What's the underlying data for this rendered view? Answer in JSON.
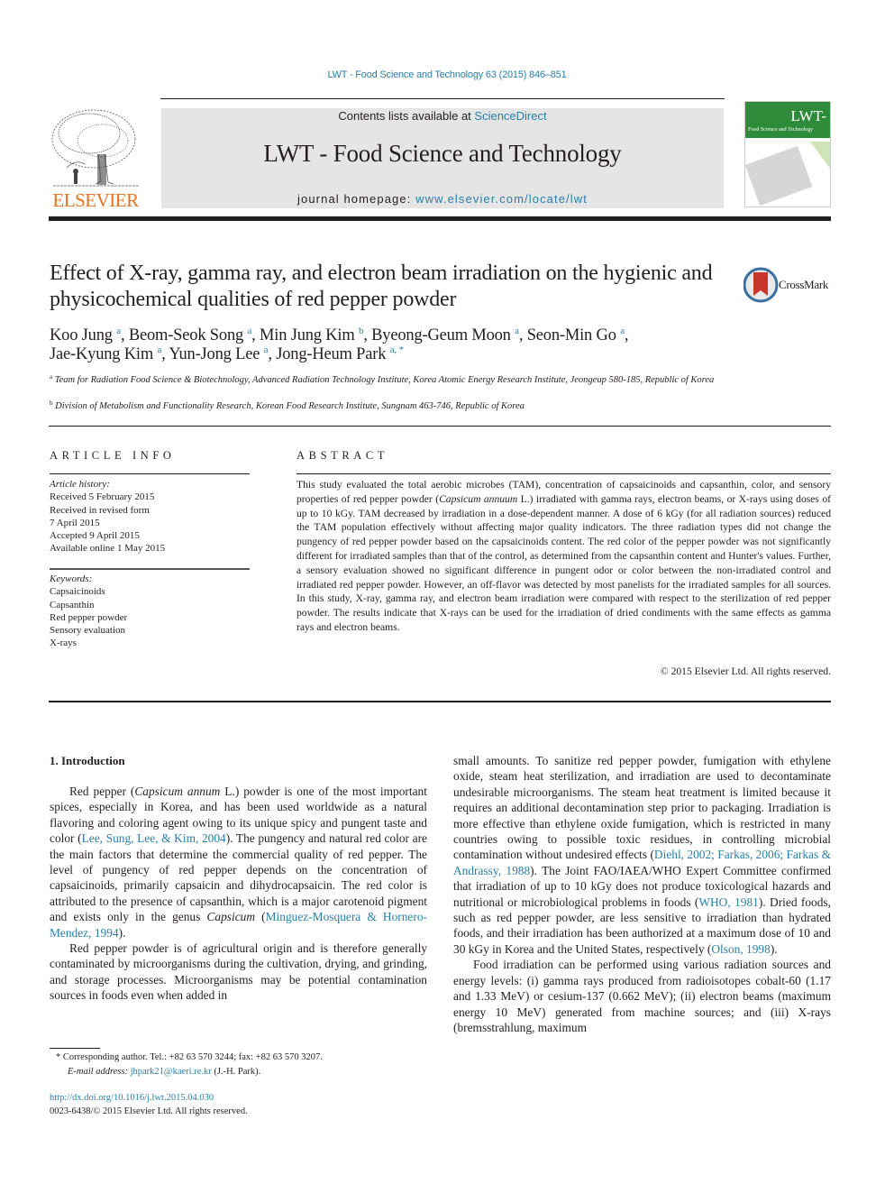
{
  "header": {
    "journal_ref": "LWT - Food Science and Technology 63 (2015) 846–851",
    "publisher": "ELSEVIER",
    "contents_prefix": "Contents lists available at ",
    "contents_link": "ScienceDirect",
    "journal_title": "LWT - Food Science and Technology",
    "homepage_prefix": "journal homepage: ",
    "homepage_link": "www.elsevier.com/locate/lwt",
    "cover_title": "LWT-",
    "cover_subtitle": "Food Science and Technology",
    "crossmark": "CrossMark"
  },
  "article": {
    "title": "Effect of X-ray, gamma ray, and electron beam irradiation on the hygienic and physicochemical qualities of red pepper powder",
    "authors": [
      {
        "name": "Koo Jung",
        "aff": "a",
        "sep": ", "
      },
      {
        "name": "Beom-Seok Song",
        "aff": "a",
        "sep": ", "
      },
      {
        "name": "Min Jung Kim",
        "aff": "b",
        "sep": ", "
      },
      {
        "name": "Byeong-Geum Moon",
        "aff": "a",
        "sep": ", "
      },
      {
        "name": "Seon-Min Go",
        "aff": "a",
        "sep": ","
      },
      {
        "name": "Jae-Kyung Kim",
        "aff": "a",
        "sep": ", "
      },
      {
        "name": "Yun-Jong Lee",
        "aff": "a",
        "sep": ", "
      },
      {
        "name": "Jong-Heum Park",
        "aff": "a, *",
        "sep": ""
      }
    ],
    "affiliations": [
      {
        "mark": "a",
        "text": "Team for Radiation Food Science & Biotechnology, Advanced Radiation Technology Institute, Korea Atomic Energy Research Institute, Jeongeup 580-185, Republic of Korea"
      },
      {
        "mark": "b",
        "text": "Division of Metabolism and Functionality Research, Korean Food Research Institute, Sungnam 463-746, Republic of Korea"
      }
    ]
  },
  "article_info": {
    "heading": "ARTICLE INFO",
    "history_label": "Article history:",
    "history": [
      "Received 5 February 2015",
      "Received in revised form",
      "7 April 2015",
      "Accepted 9 April 2015",
      "Available online 1 May 2015"
    ],
    "keywords_label": "Keywords:",
    "keywords": [
      "Capsaicinoids",
      "Capsanthin",
      "Red pepper powder",
      "Sensory evaluation",
      "X-rays"
    ]
  },
  "abstract": {
    "heading": "ABSTRACT",
    "text_1": "This study evaluated the total aerobic microbes (TAM), concentration of capsaicinoids and capsanthin, color, and sensory properties of red pepper powder (",
    "species": "Capsicum annuum",
    "text_2": " L.) irradiated with gamma rays, electron beams, or X-rays using doses of up to 10 kGy. TAM decreased by irradiation in a dose-dependent manner. A dose of 6 kGy (for all radiation sources) reduced the TAM population effectively without affecting major quality indicators. The three radiation types did not change the pungency of red pepper powder based on the capsaicinoids content. The red color of the pepper powder was not significantly different for irradiated samples than that of the control, as determined from the capsanthin content and Hunter's values. Further, a sensory evaluation showed no significant difference in pungent odor or color between the non-irradiated control and irradiated red pepper powder. However, an off-flavor was detected by most panelists for the irradiated samples for all sources. In this study, X-ray, gamma ray, and electron beam irradiation were compared with respect to the sterilization of red pepper powder. The results indicate that X-rays can be used for the irradiation of dried condiments with the same effects as gamma rays and electron beams.",
    "copyright": "© 2015 Elsevier Ltd. All rights reserved."
  },
  "intro": {
    "heading": "1.  Introduction",
    "p1_a": "Red pepper (",
    "p1_species": "Capsicum annum",
    "p1_b": " L.) powder is one of the most important spices, especially in Korea, and has been used worldwide as a natural flavoring and coloring agent owing to its unique spicy and pungent taste and color (",
    "p1_cite1": "Lee, Sung, Lee, & Kim, 2004",
    "p1_c": "). The pungency and natural red color are the main factors that determine the commercial quality of red pepper. The level of pungency of red pepper depends on the concentration of capsaicinoids, primarily capsaicin and dihydrocapsaicin. The red color is attributed to the presence of capsanthin, which is a major carotenoid pigment and exists only in the genus ",
    "p1_genus": "Capsicum",
    "p1_d": " (",
    "p1_cite2": "Minguez-Mosquera & Hornero-Mendez, 1994",
    "p1_e": ").",
    "p2": "Red pepper powder is of agricultural origin and is therefore generally contaminated by microorganisms during the cultivation, drying, and grinding, and storage processes. Microorganisms may be potential contamination sources in foods even when added in",
    "p2_cont_a": "small amounts. To sanitize red pepper powder, fumigation with ethylene oxide, steam heat sterilization, and irradiation are used to decontaminate undesirable microorganisms. The steam heat treatment is limited because it requires an additional decontamination step prior to packaging. Irradiation is more effective than ethylene oxide fumigation, which is restricted in many countries owing to possible toxic residues, in controlling microbial contamination without undesired effects (",
    "p2_cite1": "Diehl, 2002; Farkas, 2006; Farkas & Andrassy, 1988",
    "p2_cont_b": "). The Joint FAO/IAEA/WHO Expert Committee confirmed that irradiation of up to 10 kGy does not produce toxicological hazards and nutritional or microbiological problems in foods (",
    "p2_cite2": "WHO, 1981",
    "p2_cont_c": "). Dried foods, such as red pepper powder, are less sensitive to irradiation than hydrated foods, and their irradiation has been authorized at a maximum dose of 10 and 30 kGy in Korea and the United States, respectively (",
    "p2_cite3": "Olson, 1998",
    "p2_cont_d": ").",
    "p3": "Food irradiation can be performed using various radiation sources and energy levels: (i) gamma rays produced from radioisotopes cobalt-60 (1.17 and 1.33 MeV) or cesium-137 (0.662 MeV); (ii) electron beams (maximum energy 10 MeV) generated from machine sources; and (iii) X-rays (bremsstrahlung, maximum"
  },
  "footnotes": {
    "corresponding": "* Corresponding author. Tel.: +82 63 570 3244; fax: +82 63 570 3207.",
    "email_label": "E-mail address: ",
    "email": "jhpark21@kaeri.re.kr",
    "email_suffix": " (J.-H. Park).",
    "doi": "http://dx.doi.org/10.1016/j.lwt.2015.04.030",
    "issn": "0023-6438/© 2015 Elsevier Ltd. All rights reserved."
  },
  "colors": {
    "link": "#2a7fa8",
    "elsevier_orange": "#e9711c",
    "banner_bg": "#e5e5e5",
    "cover_green": "#2e8b3a"
  }
}
